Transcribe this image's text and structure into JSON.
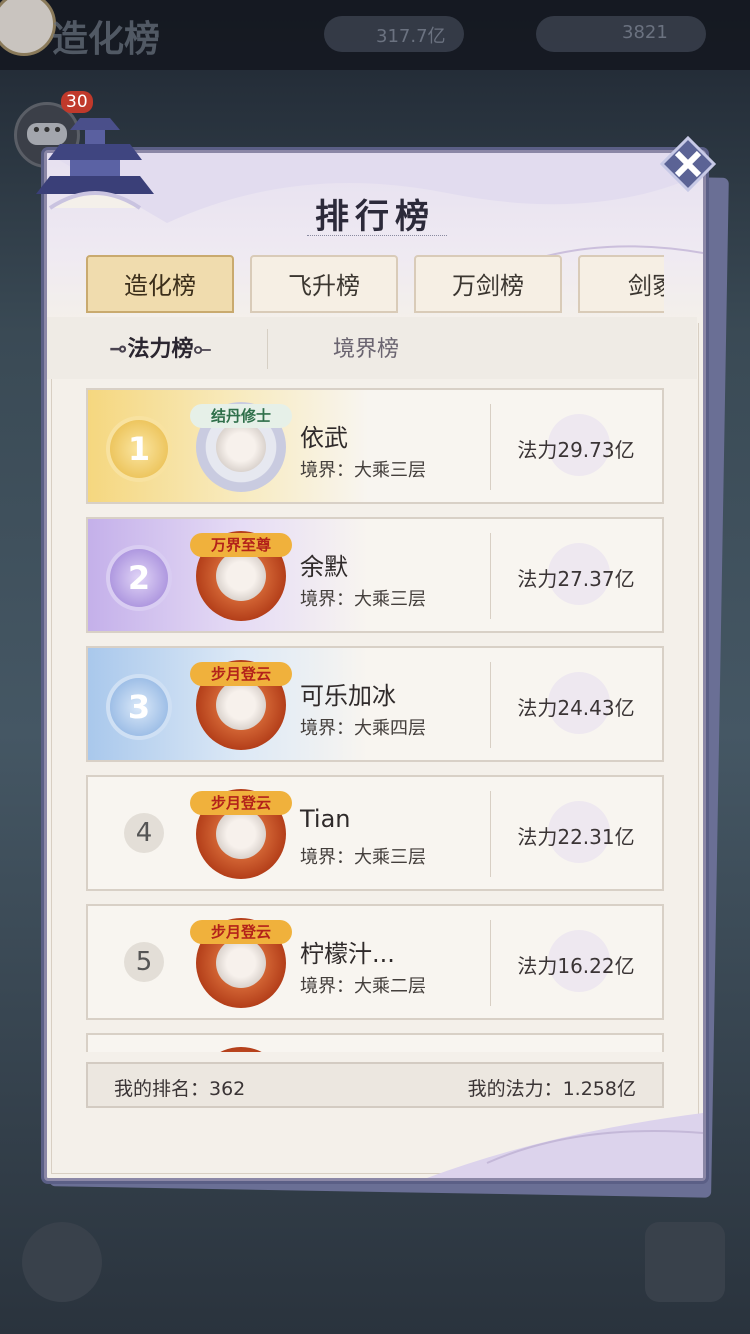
{
  "top": {
    "title": "造化榜",
    "res1": "317.7亿",
    "res2": "3821"
  },
  "chat": {
    "badge": "30"
  },
  "panel": {
    "title": "排行榜"
  },
  "tabs": [
    {
      "label": "造化榜",
      "active": true
    },
    {
      "label": "飞升榜",
      "active": false
    },
    {
      "label": "万剑榜",
      "active": false
    },
    {
      "label": "剑冢",
      "active": false
    }
  ],
  "subtabs": {
    "active": "法力榜",
    "inactive": "境界榜"
  },
  "rows": [
    {
      "rank": "1",
      "name": "依武",
      "realm": "境界：大乘三层",
      "power": "法力29.73亿",
      "ribbon": "结丹修士"
    },
    {
      "rank": "2",
      "name": "余默",
      "realm": "境界：大乘三层",
      "power": "法力27.37亿",
      "ribbon": "万界至尊"
    },
    {
      "rank": "3",
      "name": "可乐加冰",
      "realm": "境界：大乘四层",
      "power": "法力24.43亿",
      "ribbon": "步月登云"
    },
    {
      "rank": "4",
      "name": "Tian",
      "realm": "境界：大乘三层",
      "power": "法力22.31亿",
      "ribbon": "步月登云"
    },
    {
      "rank": "5",
      "name": "柠檬汁...",
      "realm": "境界：大乘二层",
      "power": "法力16.22亿",
      "ribbon": "步月登云"
    }
  ],
  "my": {
    "rank": "我的排名：362",
    "power": "我的法力：1.258亿"
  }
}
